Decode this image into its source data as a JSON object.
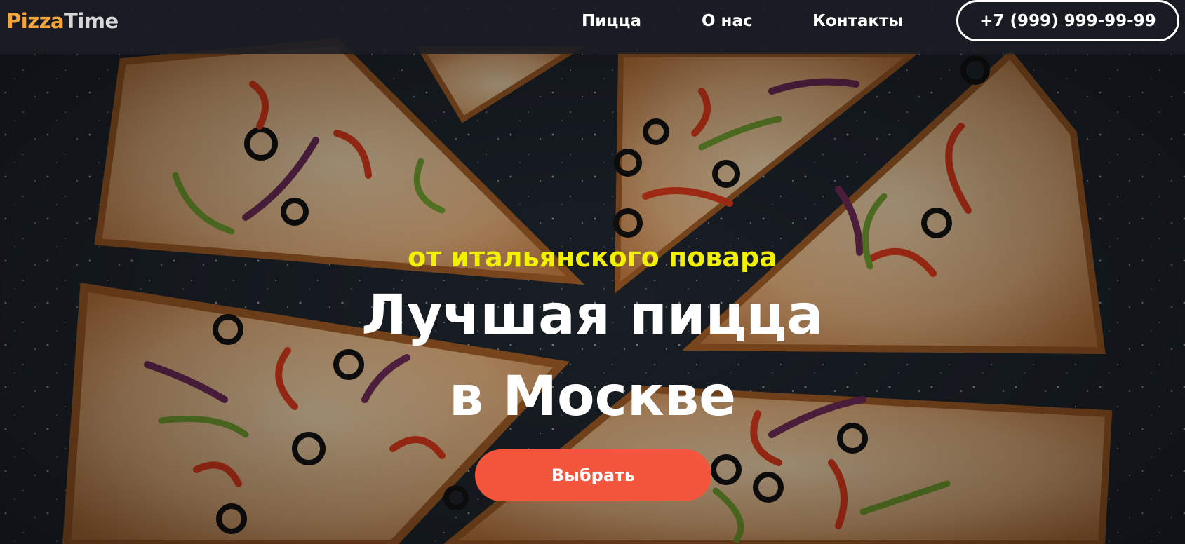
{
  "header": {
    "logo_part1": "Pizza",
    "logo_part2": "Time",
    "nav": [
      {
        "label": "Пицца"
      },
      {
        "label": "О нас"
      },
      {
        "label": "Контакты"
      }
    ],
    "phone": "+7 (999) 999-99-99"
  },
  "hero": {
    "subtitle": "от итальянского повара",
    "title_line1": "Лучшая пицца",
    "title_line2": "в Москве",
    "cta_label": "Выбрать"
  },
  "colors": {
    "logo_accent": "#f6a53a",
    "subtitle": "#f2f200",
    "cta_background": "#f4553d",
    "header_background": "#1a1e24"
  }
}
